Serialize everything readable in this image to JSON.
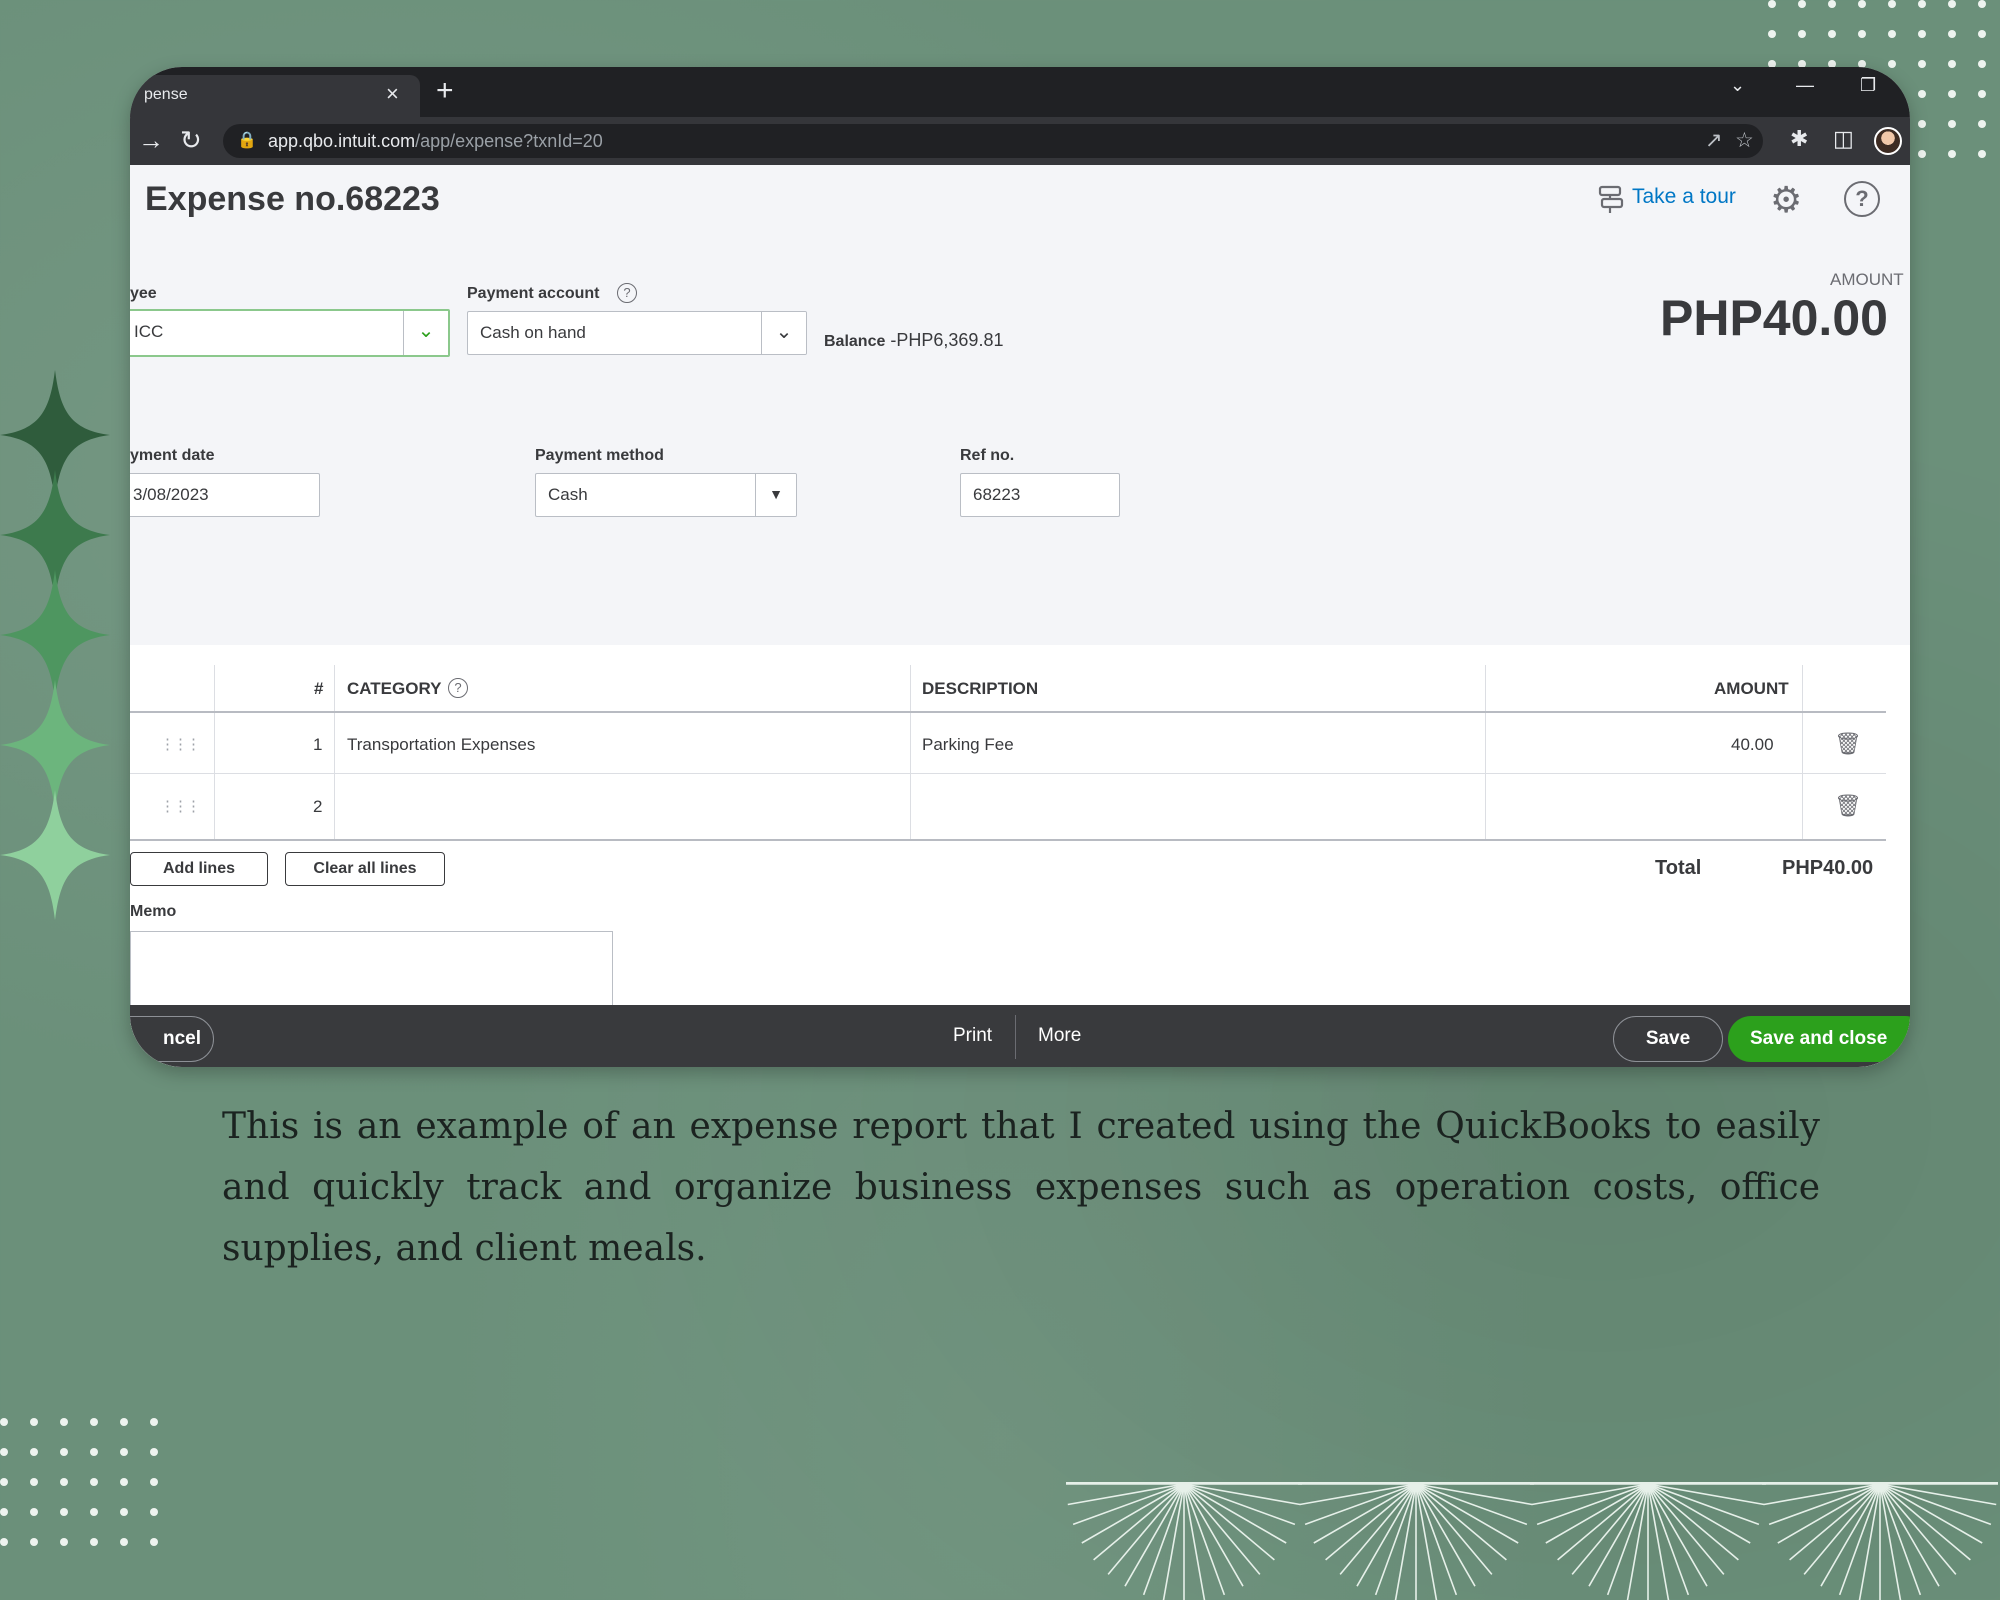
{
  "browser": {
    "tab_title": "pense",
    "tab_close": "×",
    "new_tab": "+",
    "url_host": "app.qbo.intuit.com",
    "url_path": "/app/expense?txnId=20"
  },
  "page": {
    "title": "Expense no.68223",
    "take_a_tour": "Take a tour",
    "help_symbol": "?"
  },
  "form": {
    "payee_label": "yee",
    "payee_value": "ICC",
    "payment_account_label": "Payment account",
    "payment_account_value": "Cash on hand",
    "balance_label": "Balance",
    "balance_value": "-PHP6,369.81",
    "amount_label": "AMOUNT",
    "amount_value": "PHP40.00",
    "payment_date_label": "yment date",
    "payment_date_value": "3/08/2023",
    "payment_method_label": "Payment method",
    "payment_method_value": "Cash",
    "ref_no_label": "Ref no.",
    "ref_no_value": "68223"
  },
  "table": {
    "headers": {
      "num": "#",
      "category": "CATEGORY",
      "description": "DESCRIPTION",
      "amount": "AMOUNT"
    },
    "rows": [
      {
        "num": "1",
        "category": "Transportation Expenses",
        "description": "Parking Fee",
        "amount": "40.00"
      },
      {
        "num": "2",
        "category": "",
        "description": "",
        "amount": ""
      }
    ],
    "add_lines": "Add lines",
    "clear_all_lines": "Clear all lines",
    "total_label": "Total",
    "total_value": "PHP40.00",
    "memo_label": "Memo",
    "memo_value": ""
  },
  "footer": {
    "cancel": "ncel",
    "print": "Print",
    "more": "More",
    "save": "Save",
    "save_and_close": "Save and close"
  },
  "caption": "This is an example of an expense report that I created using the QuickBooks to easily and quickly track and organize business expenses such as operation costs, office supplies, and client meals.",
  "colors": {
    "background": "#6b907a",
    "brand_green": "#2ca01c",
    "link_blue": "#0077c5",
    "footer_dark": "#393a3d"
  }
}
